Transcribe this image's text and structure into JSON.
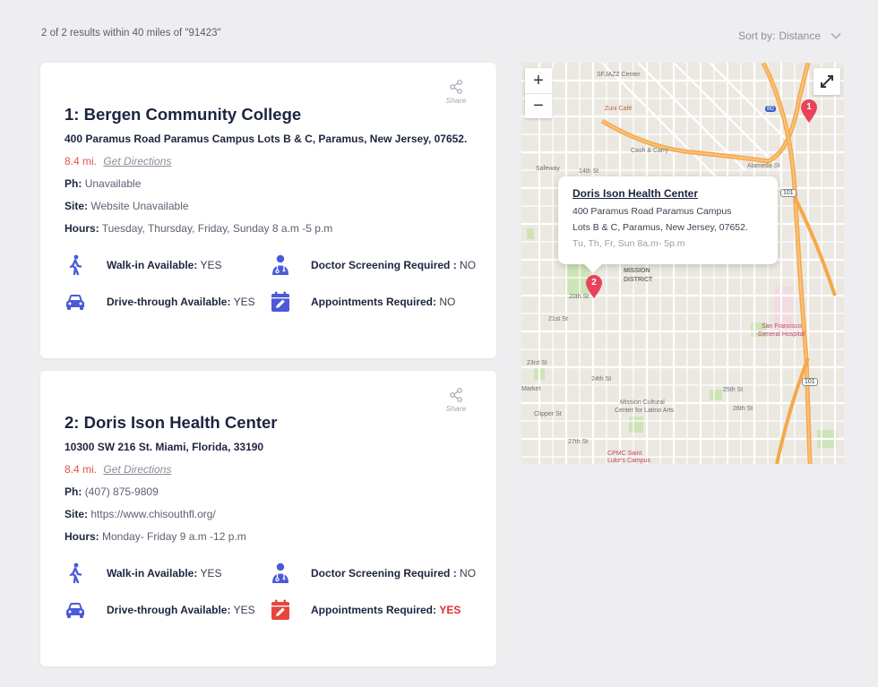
{
  "summary": "2 of 2 results within 40 miles of \"91423\"",
  "sort": {
    "label": "Sort by:",
    "value": "Distance"
  },
  "share_label": "Share",
  "colors": {
    "accent_red": "#e8504c",
    "icon_blue": "#4a5ad8",
    "required_red": "#e02d2d"
  },
  "results": [
    {
      "title": "1: Bergen Community College",
      "address": "400 Paramus Road Paramus Campus Lots B & C, Paramus, New Jersey, 07652.",
      "distance": "8.4 mi.",
      "directions": "Get Directions",
      "phone_label": "Ph:",
      "phone": "Unavailable",
      "site_label": "Site:",
      "site": "Website Unavailable",
      "hours_label": "Hours:",
      "hours": "Tuesday, Thursday, Friday, Sunday 8 a.m -5 p.m",
      "walkin_label": "Walk-in Available:",
      "walkin": "YES",
      "drive_label": "Drive-through Available:",
      "drive": "YES",
      "screening_label": "Doctor Screening Required :",
      "screening": "NO",
      "appt_label": "Appointments Required:",
      "appt": "NO"
    },
    {
      "title": "2: Doris Ison Health Center",
      "address": "10300 SW 216 St. Miami, Florida, 33190",
      "distance": "8.4 mi.",
      "directions": "Get Directions",
      "phone_label": "Ph:",
      "phone": "(407) 875-9809",
      "site_label": "Site:",
      "site": "https://www.chisouthfl.org/",
      "hours_label": "Hours:",
      "hours": "Monday- Friday 9 a.m -12 p.m",
      "walkin_label": "Walk-in Available:",
      "walkin": "YES",
      "drive_label": "Drive-through Available:",
      "drive": "YES",
      "screening_label": "Doctor Screening Required :",
      "screening": "NO",
      "appt_label": "Appointments Required:",
      "appt": "YES"
    }
  ],
  "map": {
    "zoom_in": "+",
    "zoom_out": "−",
    "popup": {
      "title": "Doris Ison Health Center",
      "line1": "400 Paramus Road Paramus Campus",
      "line2": "Lots B & C, Paramus, New Jersey, 07652.",
      "hours": "Tu, Th, Fr, Sun 8a.m- 5p.m"
    },
    "pins": [
      "1",
      "2"
    ],
    "labels": {
      "mission_district_1": "MISSION",
      "mission_district_2": "DISTRICT",
      "sf_hospital_1": "San Francisco",
      "sf_hospital_2": "General Hospital",
      "cultural_1": "Mission Cultural",
      "cultural_2": "Center for Latino Arts",
      "zuni": "Zuni Café",
      "sfjazz": "SFJAZZ Center",
      "cash": "Cash & Carry",
      "cpmc_1": "CPMC Saint",
      "cpmc_2": "Luke's Campus",
      "st_20": "20th St",
      "st_21": "21st St",
      "st_23": "23rd St",
      "st_24": "24th St",
      "st_25": "25th St",
      "st_26": "26th St",
      "st_27": "27th St",
      "clipper": "Clipper St",
      "market": "Market",
      "alameda": "Alameda St",
      "fourteenth": "14th St",
      "safeway": "Safeway",
      "hwy101a": "101",
      "hwy101b": "101",
      "hwy80": "80"
    }
  }
}
